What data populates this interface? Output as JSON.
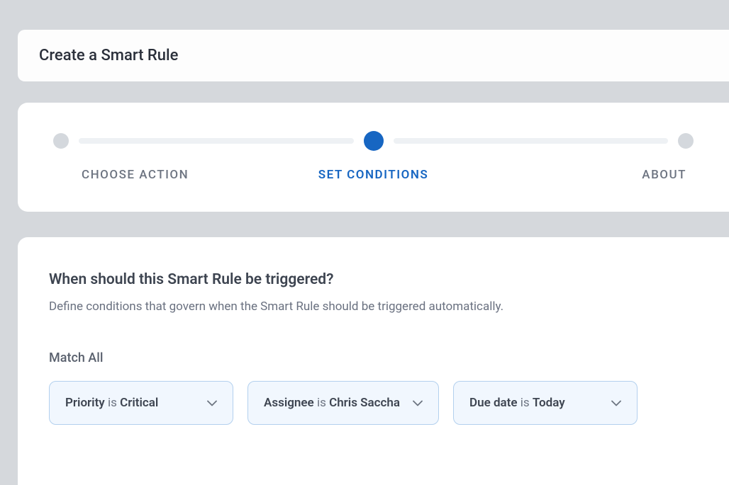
{
  "header": {
    "title": "Create a Smart Rule"
  },
  "stepper": {
    "steps": [
      {
        "label": "CHOOSE ACTION",
        "active": false
      },
      {
        "label": "SET CONDITIONS",
        "active": true
      },
      {
        "label": "ABOUT",
        "active": false
      }
    ]
  },
  "conditions": {
    "title": "When should this Smart Rule be triggered?",
    "subtitle": "Define conditions that govern when the Smart Rule should be triggered automatically.",
    "match_label": "Match All",
    "items": [
      {
        "field": "Priority",
        "operator": "is",
        "value": "Critical"
      },
      {
        "field": "Assignee",
        "operator": "is",
        "value": "Chris Saccha"
      },
      {
        "field": "Due date",
        "operator": "is",
        "value": "Today"
      }
    ]
  }
}
